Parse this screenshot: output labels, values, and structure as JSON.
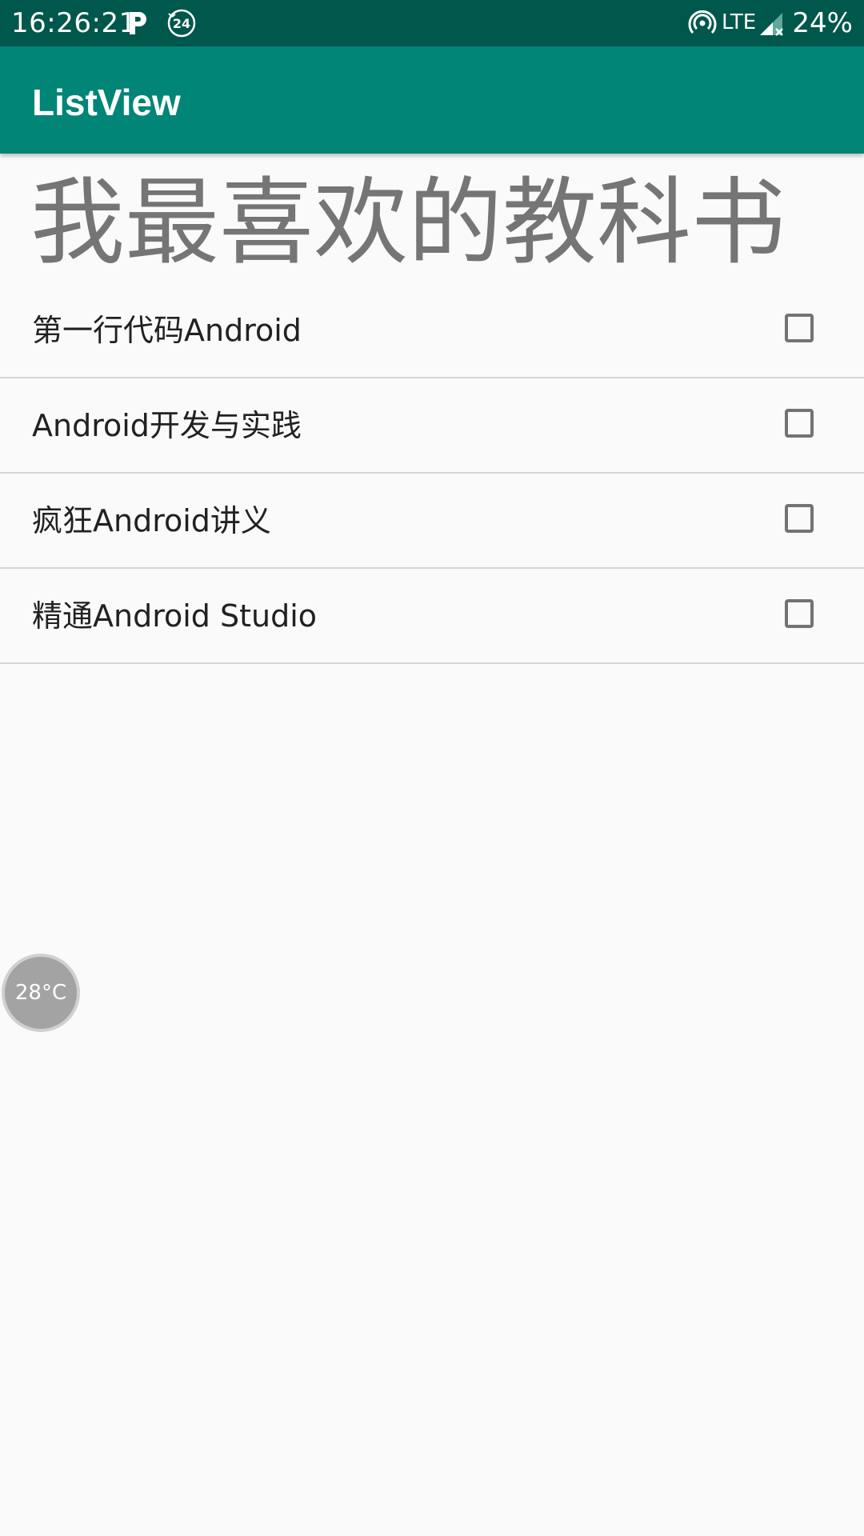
{
  "status_bar": {
    "time": "16:26:21",
    "network": "LTE",
    "battery": "24%",
    "icons": [
      "parking-app-icon",
      "24-hour-icon",
      "hotspot-icon",
      "signal-icon"
    ]
  },
  "app_bar": {
    "title": "ListView"
  },
  "heading": "我最喜欢的教科书",
  "list": {
    "items": [
      {
        "label": "第一行代码Android",
        "checked": false
      },
      {
        "label": "Android开发与实践",
        "checked": false
      },
      {
        "label": "疯狂Android讲义",
        "checked": false
      },
      {
        "label": "精通Android Studio",
        "checked": false
      }
    ]
  },
  "weather_bubble": {
    "text": "28°C"
  },
  "colors": {
    "status_bar": "#00574b",
    "app_bar": "#008577",
    "background": "#fafafa",
    "heading_text": "#757575",
    "checkbox_border": "#737373"
  }
}
